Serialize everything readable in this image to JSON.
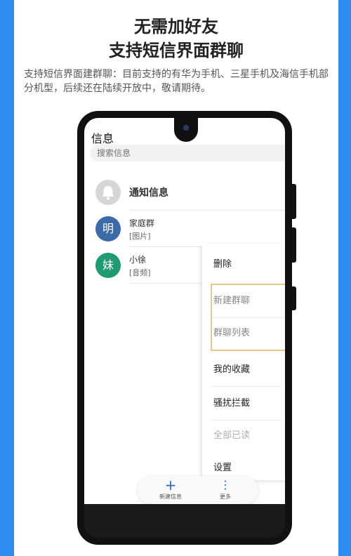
{
  "header": {
    "title_line1": "无需加好友",
    "title_line2": "支持短信界面群聊",
    "description": "支持短信界面建群聊：目前支持的有华为手机、三星手机及海信手机部分机型，后续还在陆续开放中，敬请期待。"
  },
  "app": {
    "title": "信息",
    "search_placeholder": "搜索信息",
    "conversations": [
      {
        "avatar_char": "",
        "name": "通知信息",
        "preview": "",
        "avatar_color": "#d6d6d6",
        "icon": "bell-icon"
      },
      {
        "avatar_char": "明",
        "name": "家庭群",
        "preview": "[图片]",
        "avatar_color": "#3d6aa8"
      },
      {
        "avatar_char": "妹",
        "name": "小徐",
        "preview": "[音频]",
        "avatar_color": "#1f9a72"
      }
    ],
    "menu": [
      {
        "label": "删除"
      },
      {
        "label": "新建群聊"
      },
      {
        "label": "群聊列表"
      },
      {
        "label": "我的收藏"
      },
      {
        "label": "骚扰拦截"
      },
      {
        "label": "全部已读"
      },
      {
        "label": "设置"
      }
    ],
    "bottom_bar": {
      "new_label": "新建信息",
      "more_label": "更多"
    }
  }
}
